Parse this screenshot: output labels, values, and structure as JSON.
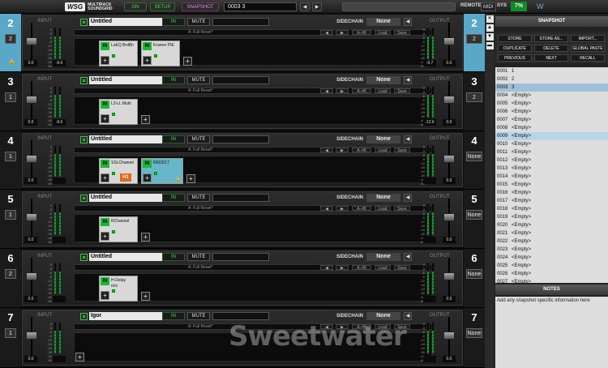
{
  "topbar": {
    "logo_main": "WSG",
    "logo_sub1": "MULTIRACK",
    "logo_sub2": "SOUNDGRID",
    "on": "ON",
    "setup": "SETUP",
    "snapshot": "SNAPSHOT",
    "snapshot_value": "0003 3",
    "remote": "REMOTE",
    "midi": "MIDI",
    "sys": "SYS",
    "cpu": "7%",
    "waves": "W"
  },
  "labels": {
    "input": "INPUT",
    "output": "OUTPUT",
    "in": "IN",
    "mute": "MUTE",
    "sidechain": "SIDECHAIN",
    "none": "None",
    "preset": "A: Full Reset*",
    "ab": "A->B",
    "load": "Load",
    "save": "Save",
    "plus": "+"
  },
  "strips": [
    {
      "num": "2",
      "selected": true,
      "name": "Untitled",
      "in_read": "0.0",
      "in_peak": "-9.6",
      "out_read": "0.0",
      "out_peak": "-9.7",
      "out_btn": "2",
      "in_btn": "2",
      "plugins": [
        {
          "name": "LoEQ BrdBn",
          "sub": "",
          "blue": false
        },
        {
          "name": "Kramer PIE",
          "sub": "",
          "blue": false
        }
      ]
    },
    {
      "num": "3",
      "selected": false,
      "name": "Untitled",
      "in_read": "0.0",
      "in_peak": "-9.6",
      "out_read": "0.0",
      "out_peak": "-12.6",
      "out_btn": "2",
      "in_btn": "1",
      "plugins": [
        {
          "name": "L3-LL Multi",
          "sub": "",
          "blue": false
        }
      ]
    },
    {
      "num": "4",
      "selected": false,
      "name": "Untitled",
      "in_read": "0.0",
      "in_peak": "",
      "out_read": "0.0",
      "out_peak": "",
      "out_btn": "None",
      "in_btn": "1",
      "plugins": [
        {
          "name": "SSLChannel",
          "sub": "",
          "blue": false,
          "h1": "H1"
        },
        {
          "name": "REDD17",
          "sub": "",
          "blue": true
        }
      ]
    },
    {
      "num": "5",
      "selected": false,
      "name": "Untitled",
      "in_read": "0.0",
      "in_peak": "",
      "out_read": "0.0",
      "out_peak": "",
      "out_btn": "None",
      "in_btn": "1",
      "plugins": [
        {
          "name": "RChannel",
          "sub": "",
          "blue": false
        }
      ]
    },
    {
      "num": "6",
      "selected": false,
      "name": "Untitled",
      "in_read": "0.0",
      "in_peak": "",
      "out_read": "0.0",
      "out_peak": "",
      "out_btn": "None",
      "in_btn": "2",
      "plugins": [
        {
          "name": "H-Delay",
          "sub": "m/s",
          "blue": false
        }
      ]
    },
    {
      "num": "7",
      "selected": false,
      "name": "Igor",
      "in_read": "0.0",
      "in_peak": "",
      "out_read": "0.0",
      "out_peak": "",
      "out_btn": "None",
      "in_btn": "1",
      "plugins": []
    }
  ],
  "scale": [
    "0",
    "-3",
    "-6",
    "-9",
    "-12",
    "-18",
    "-24",
    "-30",
    "-40",
    "-60"
  ],
  "snapshot_panel": {
    "title": "SNAPSHOT",
    "buttons": [
      "STORE",
      "STORE AS...",
      "IMPORT...",
      "DUPLICATE",
      "DELETE",
      "GLOBAL PASTE",
      "PREVIOUS",
      "NEXT",
      "RECALL"
    ],
    "items": [
      [
        "0001",
        "1"
      ],
      [
        "0002",
        "2"
      ],
      [
        "0003",
        "3"
      ],
      [
        "0004",
        "<Empty>"
      ],
      [
        "0005",
        "<Empty>"
      ],
      [
        "0006",
        "<Empty>"
      ],
      [
        "0007",
        "<Empty>"
      ],
      [
        "0008",
        "<Empty>"
      ],
      [
        "0009",
        "<Empty>"
      ],
      [
        "0010",
        "<Empty>"
      ],
      [
        "0011",
        "<Empty>"
      ],
      [
        "0012",
        "<Empty>"
      ],
      [
        "0013",
        "<Empty>"
      ],
      [
        "0014",
        "<Empty>"
      ],
      [
        "0015",
        "<Empty>"
      ],
      [
        "0016",
        "<Empty>"
      ],
      [
        "0017",
        "<Empty>"
      ],
      [
        "0018",
        "<Empty>"
      ],
      [
        "0019",
        "<Empty>"
      ],
      [
        "0020",
        "<Empty>"
      ],
      [
        "0021",
        "<Empty>"
      ],
      [
        "0022",
        "<Empty>"
      ],
      [
        "0023",
        "<Empty>"
      ],
      [
        "0024",
        "<Empty>"
      ],
      [
        "0025",
        "<Empty>"
      ],
      [
        "0026",
        "<Empty>"
      ],
      [
        "0027",
        "<Empty>"
      ]
    ],
    "current": "0003",
    "highlight": "0009"
  },
  "notes": {
    "title": "NOTES",
    "text": "Add any snapshot specific information here"
  },
  "watermark": "Sweetwater"
}
